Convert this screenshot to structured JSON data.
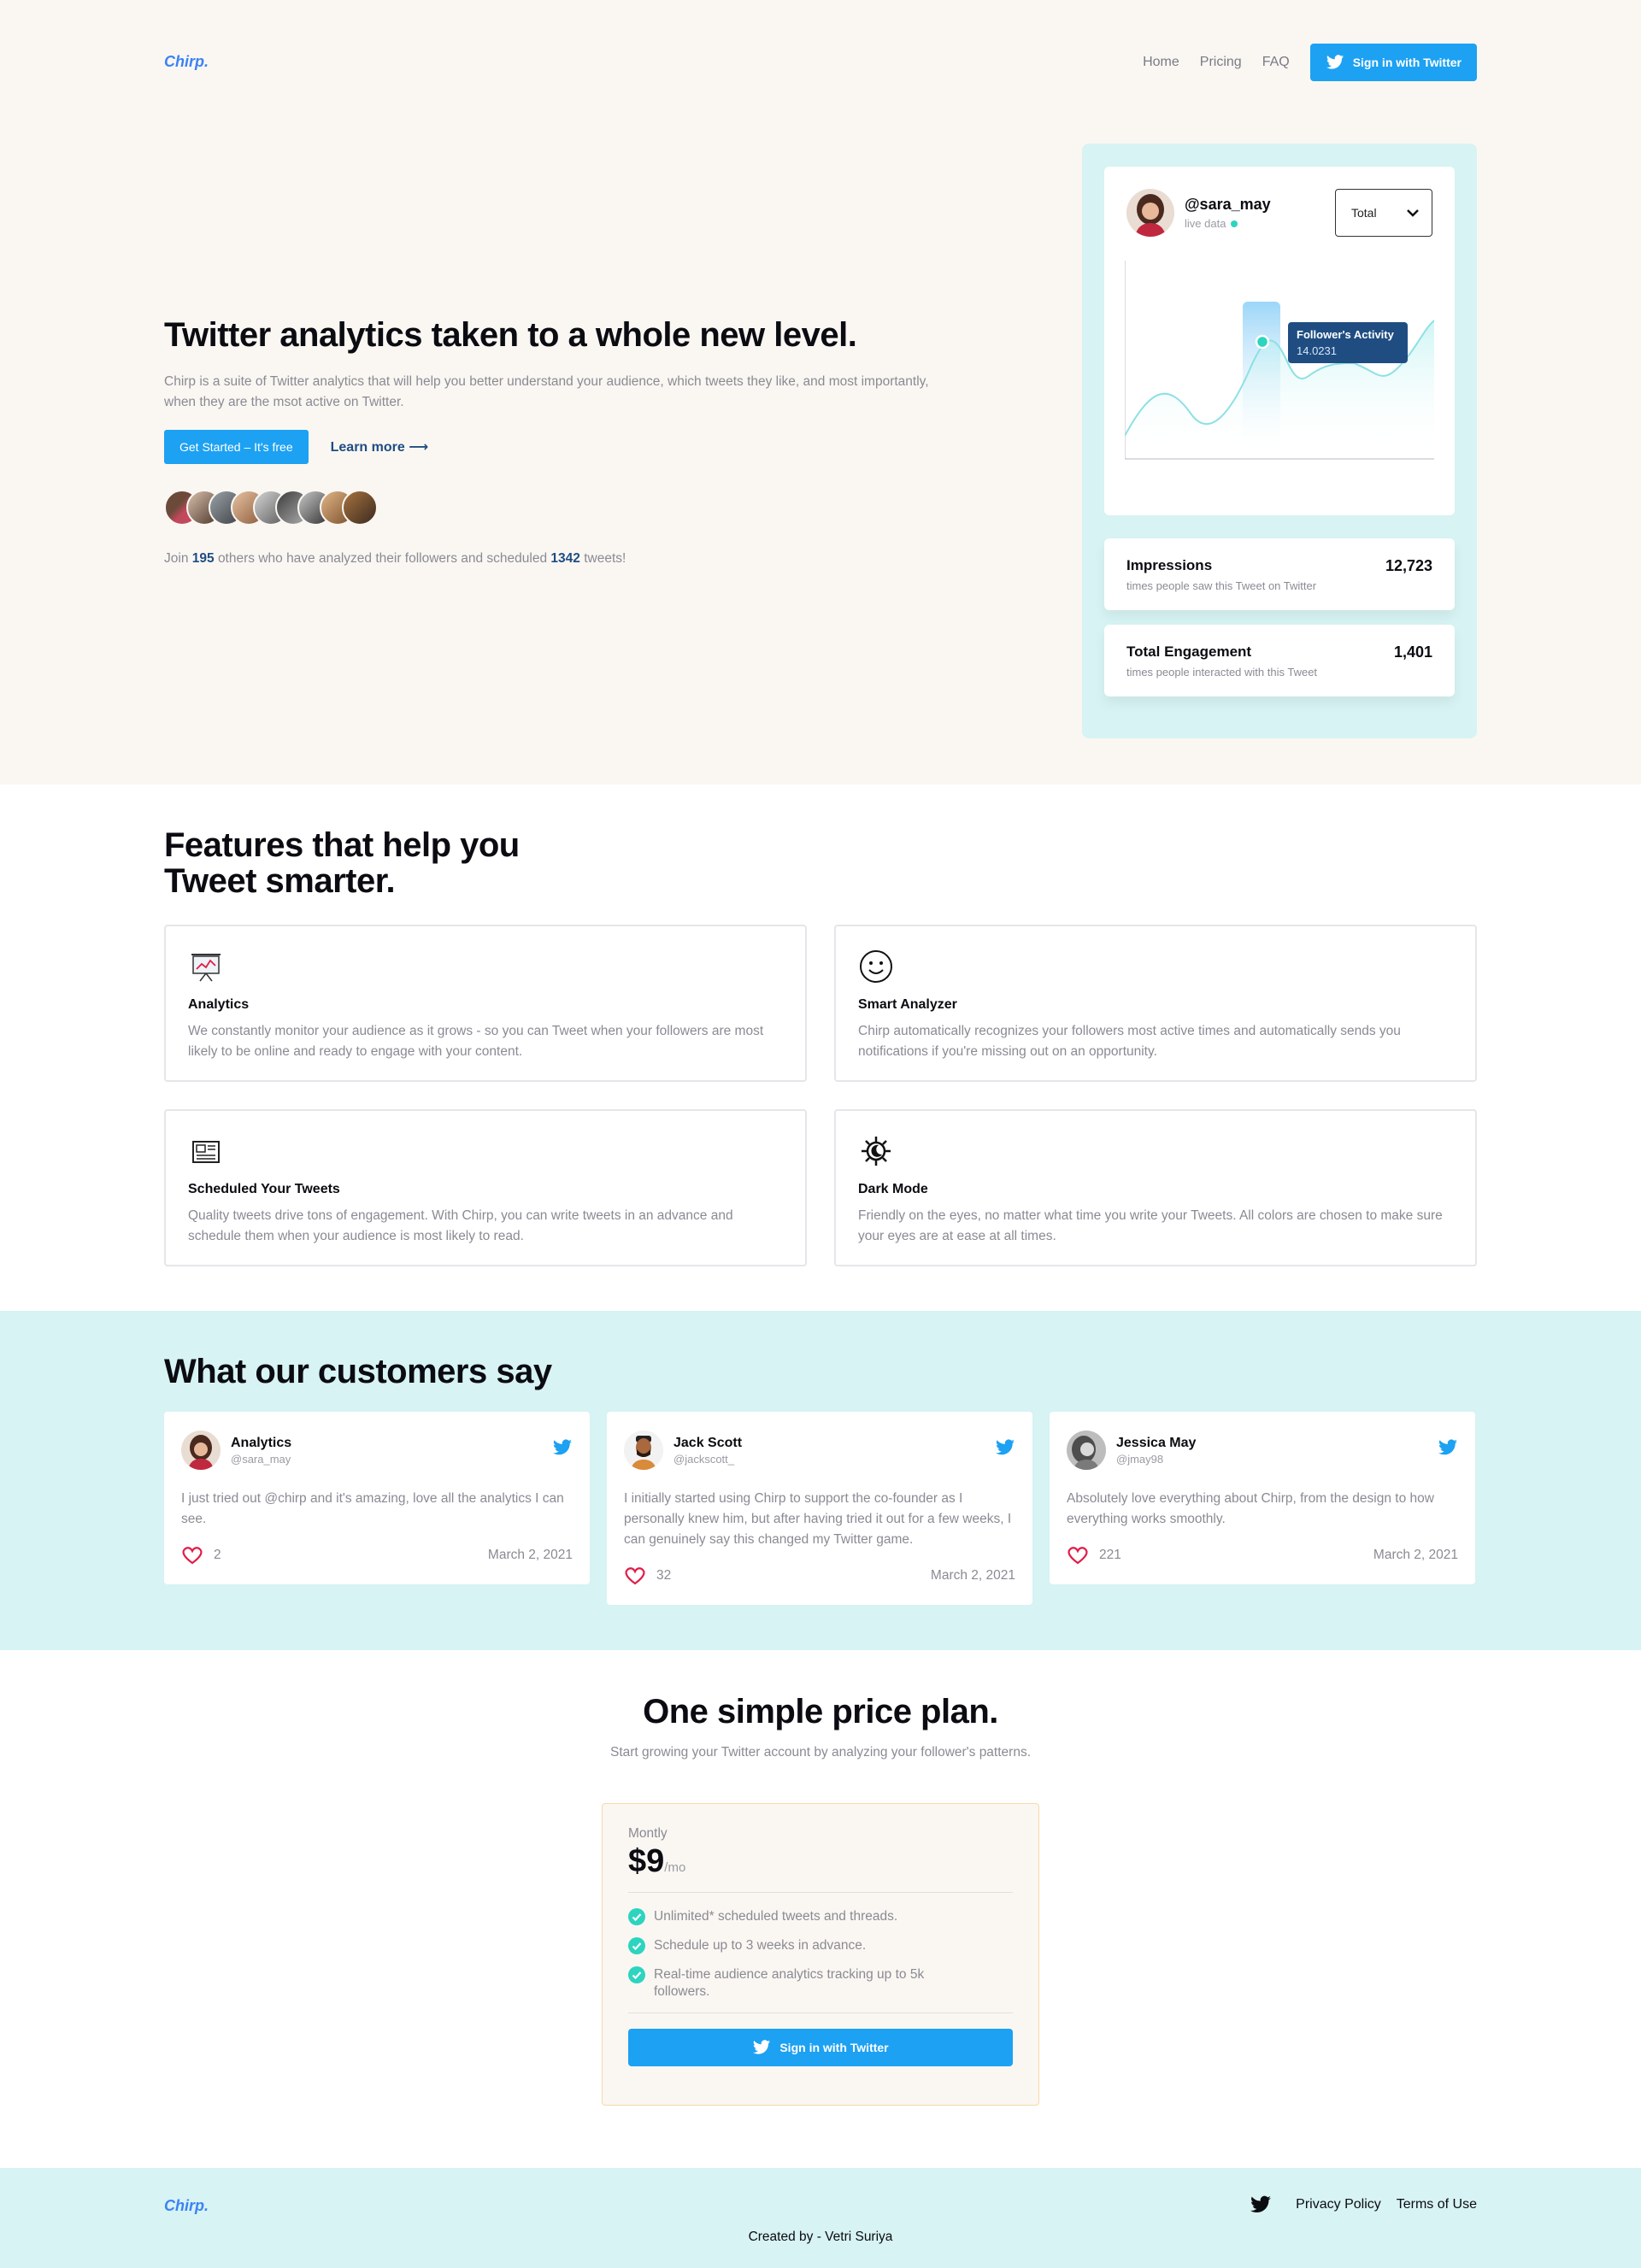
{
  "brand": {
    "name": "Chirp."
  },
  "nav": {
    "links": [
      "Home",
      "Pricing",
      "FAQ"
    ],
    "signin_label": "Sign in with Twitter"
  },
  "hero": {
    "title": "Twitter analytics taken to a whole new level.",
    "description": "Chirp is a suite of Twitter analytics that will help you better understand your audience, which tweets they like, and most importantly, when they are the msot active on Twitter.",
    "cta_primary": "Get Started –  It's free",
    "cta_secondary": "Learn more ⟶",
    "join": {
      "prefix": "Join",
      "users": "195",
      "middle": "others who have analyzed their followers and scheduled",
      "tweets": "1342",
      "suffix": "tweets!"
    }
  },
  "dashboard": {
    "handle": "@sara_may",
    "status": "live data",
    "filter": "Total",
    "tooltip": {
      "title": "Follower's Activity",
      "value": "14.0231"
    },
    "stats": [
      {
        "label": "Impressions",
        "sub": "times people saw this Tweet on Twitter",
        "value": "12,723"
      },
      {
        "label": "Total Engagement",
        "sub": "times people interacted with this Tweet",
        "value": "1,401"
      }
    ]
  },
  "features": {
    "title_line1": "Features that help you",
    "title_line2": "Tweet smarter.",
    "items": [
      {
        "icon": "presentation-chart-icon",
        "title": "Analytics",
        "desc": "We constantly monitor your audience as it grows - so you can Tweet when your followers are most likely to be online and ready to engage with your content."
      },
      {
        "icon": "smiley-icon",
        "title": "Smart Analyzer",
        "desc": "Chirp automatically recognizes your followers most active times and automatically sends you notifications if you're missing out on an opportunity."
      },
      {
        "icon": "newspaper-icon",
        "title": "Scheduled Your Tweets",
        "desc": "Quality tweets drive tons of engagement. With Chirp, you can write tweets in an advance and schedule them when your audience is most likely to read."
      },
      {
        "icon": "moon-sun-icon",
        "title": "Dark Mode",
        "desc": "Friendly on the eyes, no matter what time you write your Tweets. All colors are chosen to make sure your eyes are at ease at all times."
      }
    ]
  },
  "testimonials": {
    "title": "What our customers say",
    "items": [
      {
        "name": "Analytics",
        "handle": "@sara_may",
        "text": "I just tried out @chirp and it's amazing, love all the analytics I can see.",
        "likes": "2",
        "date": "March 2, 2021"
      },
      {
        "name": "Jack Scott",
        "handle": "@jackscott_",
        "text": "I initially started using Chirp to support the co-founder as I personally knew him, but after having tried it out for a few weeks, I can genuinely say this changed my Twitter game.",
        "likes": "32",
        "date": "March 2, 2021"
      },
      {
        "name": "Jessica May",
        "handle": "@jmay98",
        "text": "Absolutely love everything about Chirp, from the design to how everything works smoothly.",
        "likes": "221",
        "date": "March 2, 2021"
      }
    ]
  },
  "pricing": {
    "title": "One simple price plan.",
    "subtitle": "Start growing your Twitter account by analyzing your follower's patterns.",
    "plan": "Montly",
    "amount": "$9",
    "period": "/mo",
    "perks": [
      "Unlimited* scheduled tweets and threads.",
      "Schedule up to 3 weeks in advance.",
      "Real-time audience analytics tracking up to 5k followers."
    ],
    "button": "Sign in with Twitter"
  },
  "footer": {
    "links": [
      "Privacy Policy",
      "Terms of Use"
    ],
    "credit": "Created by - Vetri Suriya"
  },
  "colors": {
    "accent": "#1da1f2",
    "cream": "#faf7f2",
    "mint": "#d7f3f3",
    "navy": "#1f4d82"
  }
}
